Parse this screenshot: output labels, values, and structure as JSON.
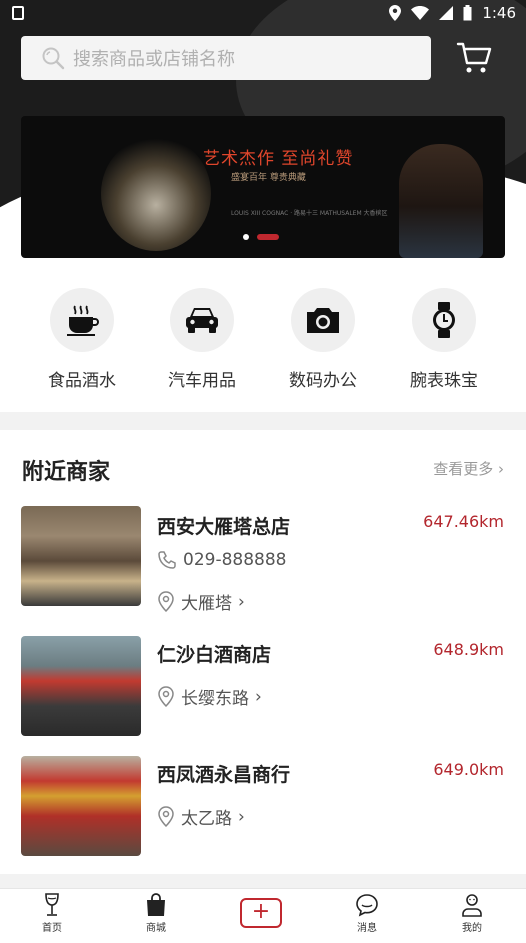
{
  "status_bar": {
    "time": "1:46"
  },
  "search": {
    "placeholder": "搜索商品或店铺名称"
  },
  "banner": {
    "headline": "艺术杰作  至尚礼赞",
    "subline": "盛宴百年    尊贵典藏",
    "fineprint": "LOUIS XIII COGNAC · 路易十三 MATHUSALEM 大香槟区"
  },
  "categories": [
    {
      "label": "食品酒水",
      "icon": "coffee-cup-icon"
    },
    {
      "label": "汽车用品",
      "icon": "car-icon"
    },
    {
      "label": "数码办公",
      "icon": "camera-icon"
    },
    {
      "label": "腕表珠宝",
      "icon": "watch-icon"
    }
  ],
  "nearby": {
    "title": "附近商家",
    "more": "查看更多",
    "shops": [
      {
        "name": "西安大雁塔总店",
        "distance": "647.46km",
        "phone": "029-888888",
        "address": "大雁塔"
      },
      {
        "name": "仁沙白酒商店",
        "distance": "648.9km",
        "address": "长缨东路"
      },
      {
        "name": "西凤酒永昌商行",
        "distance": "649.0km",
        "address": "太乙路"
      }
    ]
  },
  "tabbar": {
    "home": "首页",
    "mall": "商城",
    "add": "+",
    "messages": "消息",
    "mine": "我的"
  },
  "colors": {
    "accent": "#c0282f",
    "header_bg": "#1c1c1c",
    "price_red": "#b3262d"
  }
}
